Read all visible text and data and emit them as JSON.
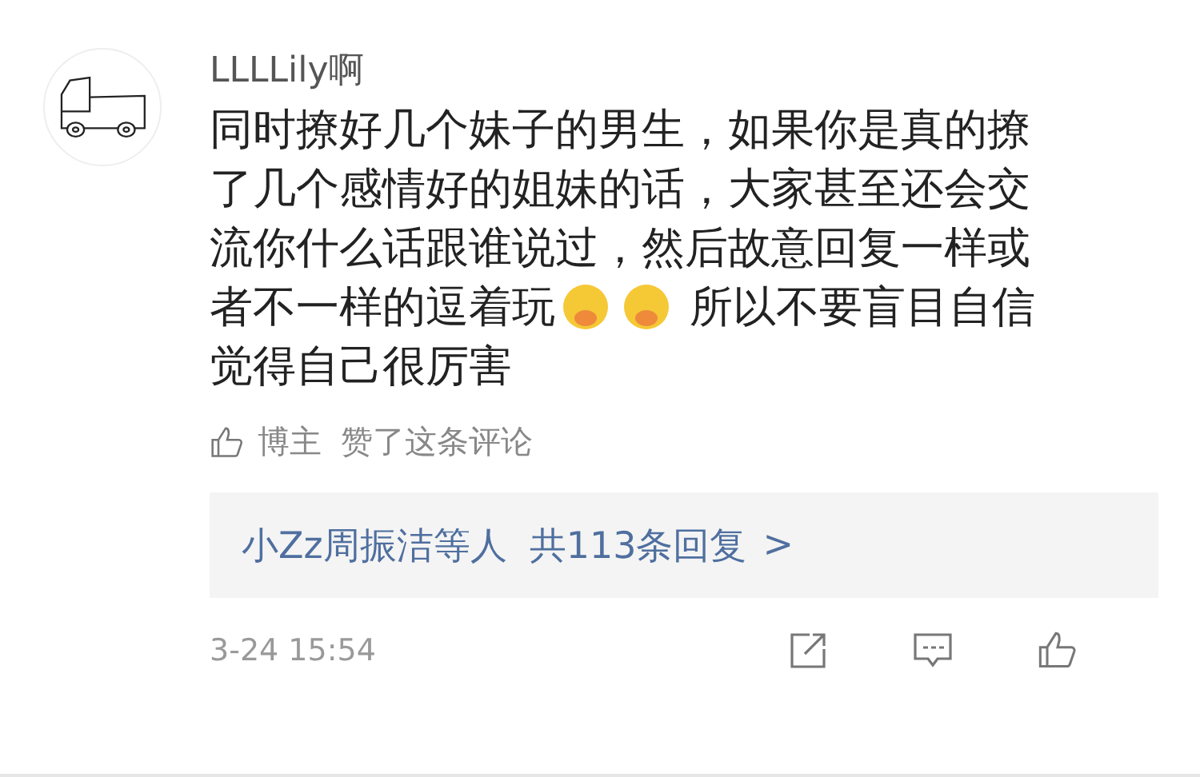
{
  "comment": {
    "author": "LLLLily啊",
    "lines": [
      [
        {
          "kind": "text",
          "text": "同时撩好几个妹子的男生，如果你是真的撩"
        }
      ],
      [
        {
          "kind": "text",
          "text": "了几个感情好的姐妹的话，大家甚至还会交"
        }
      ],
      [
        {
          "kind": "text",
          "text": "流你什么话跟谁说过，然后故意回复一样或"
        }
      ],
      [
        {
          "kind": "text",
          "text": "者不一样的逗着玩"
        },
        {
          "kind": "emoji"
        },
        {
          "kind": "emoji"
        },
        {
          "kind": "text",
          "text": "所以不要盲目自信"
        }
      ],
      [
        {
          "kind": "text",
          "text": "觉得自己很厉害"
        }
      ]
    ],
    "liked_by": {
      "who": "博主",
      "text": "赞了这条评论"
    },
    "replies": {
      "names": "小Zz周振洁等人",
      "count": "共113条回复",
      "arrow": ">"
    },
    "time": "3-24 15:54"
  }
}
